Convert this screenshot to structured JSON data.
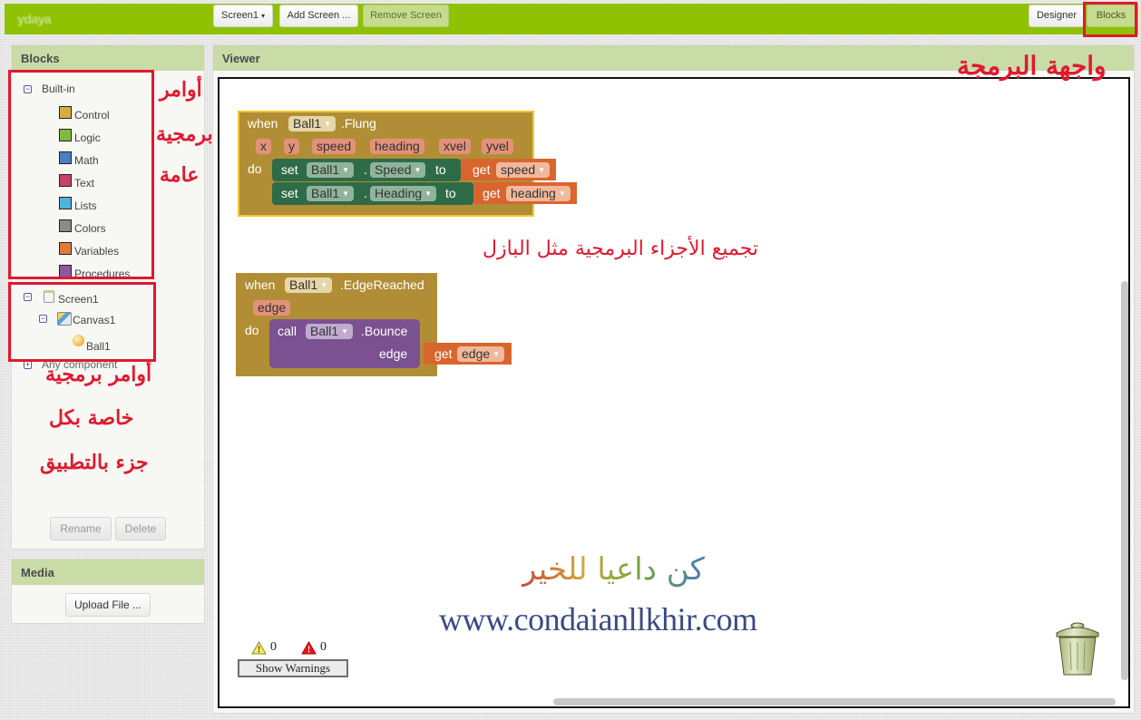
{
  "topbar": {
    "logo": "ydaya",
    "screen_select": "Screen1",
    "add_screen": "Add Screen ...",
    "remove_screen": "Remove Screen",
    "designer": "Designer",
    "blocks": "Blocks"
  },
  "blocks_panel": {
    "title": "Blocks",
    "builtin": {
      "label": "Built-in",
      "items": [
        {
          "label": "Control",
          "color": "#d8ae42"
        },
        {
          "label": "Logic",
          "color": "#83b942"
        },
        {
          "label": "Math",
          "color": "#4a80c3"
        },
        {
          "label": "Text",
          "color": "#c4426e"
        },
        {
          "label": "Lists",
          "color": "#4fb3e0"
        },
        {
          "label": "Colors",
          "color": "#8a8a8a"
        },
        {
          "label": "Variables",
          "color": "#e07a3a"
        },
        {
          "label": "Procedures",
          "color": "#8c5a9c"
        }
      ]
    },
    "components": {
      "screen": "Screen1",
      "canvas": "Canvas1",
      "ball": "Ball1",
      "any_component": "Any component"
    },
    "rename": "Rename",
    "delete": "Delete"
  },
  "media_panel": {
    "title": "Media",
    "upload": "Upload File ..."
  },
  "viewer": {
    "title": "Viewer",
    "flung_block": {
      "when": "when",
      "component": "Ball1",
      "event": ".Flung",
      "params": [
        "x",
        "y",
        "speed",
        "heading",
        "xvel",
        "yvel"
      ],
      "do": "do",
      "statements": [
        {
          "set": "set",
          "component": "Ball1",
          "dot": ".",
          "property": "Speed",
          "to": "to",
          "get": "get",
          "var": "speed"
        },
        {
          "set": "set",
          "component": "Ball1",
          "dot": ".",
          "property": "Heading",
          "to": "to",
          "get": "get",
          "var": "heading"
        }
      ]
    },
    "edge_block": {
      "when": "when",
      "component": "Ball1",
      "event": ".EdgeReached",
      "params": [
        "edge"
      ],
      "do": "do",
      "call": "call",
      "call_component": "Ball1",
      "method": ".Bounce",
      "arg_label": "edge",
      "get": "get",
      "var": "edge"
    },
    "warnings": {
      "warning_count": "0",
      "error_count": "0",
      "show_warnings": "Show Warnings"
    }
  },
  "annotations": {
    "blocks_interface": "واجهة البرمجة",
    "general_commands": [
      "أوامر",
      "برمجية",
      "عامة"
    ],
    "component_commands": [
      "أوامر برمجية",
      "خاصة بكل",
      "جزء بالتطبيق"
    ],
    "puzzle_note": "تجميع الأجزاء البرمجية مثل البازل",
    "watermark_arabic": "كن داعيا للخير",
    "watermark_url": "www.condaianllkhir.com"
  },
  "colors": {
    "topbar": "#8fc202",
    "panel_header": "#c9dba7",
    "annotation_red": "#e0192f",
    "event_block": "#b18e35",
    "set_block": "#2e6b48",
    "get_block": "#d9652e",
    "call_block": "#7b5191"
  }
}
